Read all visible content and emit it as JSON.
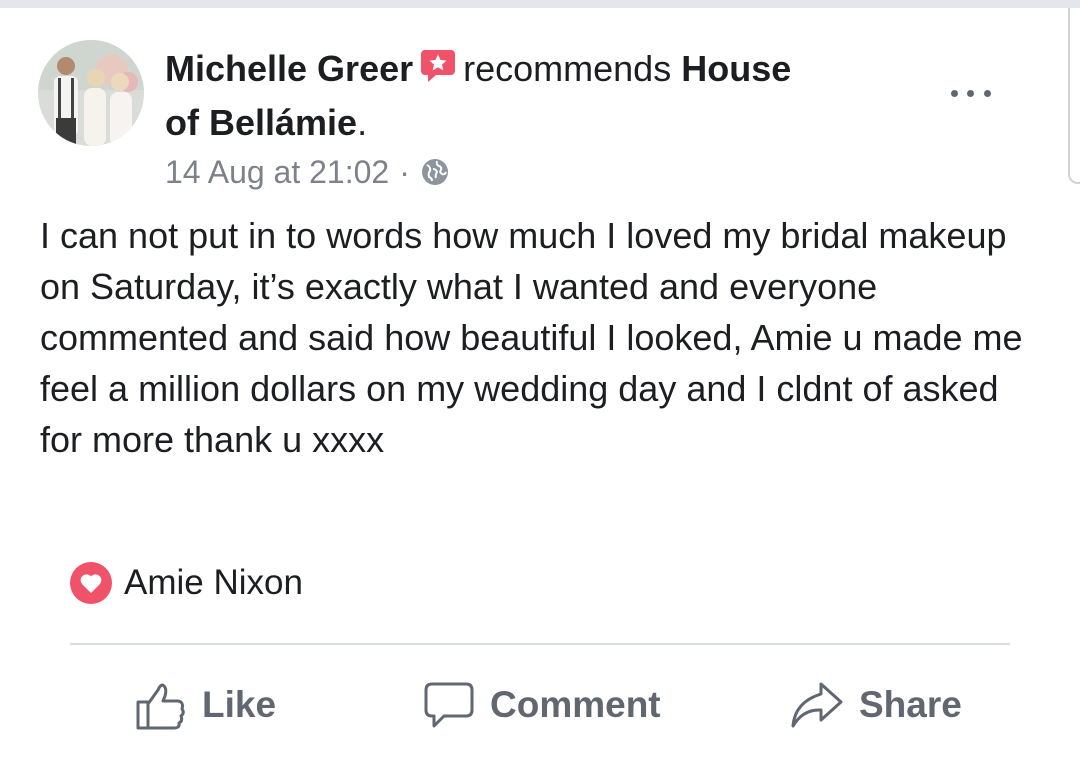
{
  "post": {
    "author": "Michelle Greer",
    "verb": "recommends",
    "page_name": "House of Bellámie",
    "page_name_line1": "House",
    "page_name_line2": "of Bellámie",
    "period": ".",
    "timestamp": "14 Aug at 21:02",
    "separator": "·",
    "privacy_icon": "globe-icon",
    "body": "I can not put in to words how much I loved my bridal makeup on Saturday, it’s exactly what I wanted and everyone commented and said how beautiful I looked, Amie u made me feel a million dollars on my wedding day and I cldnt of asked for more thank u xxxx",
    "more_icon": "more-options-icon"
  },
  "reactions": {
    "icon": "heart-reaction-icon",
    "color": "#f0526a",
    "names": "Amie Nixon"
  },
  "actions": {
    "like_label": "Like",
    "comment_label": "Comment",
    "share_label": "Share"
  },
  "colors": {
    "recommend_badge": "#f0526a",
    "secondary_text": "#7d828a",
    "action_text": "#606770"
  }
}
